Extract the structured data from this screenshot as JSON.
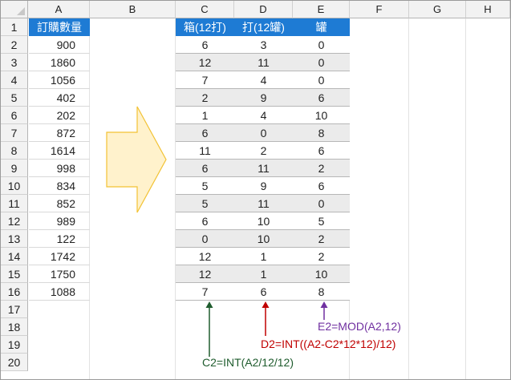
{
  "columns": [
    "A",
    "B",
    "C",
    "D",
    "E",
    "F",
    "G",
    "H"
  ],
  "rows": [
    "1",
    "2",
    "3",
    "4",
    "5",
    "6",
    "7",
    "8",
    "9",
    "10",
    "11",
    "12",
    "13",
    "14",
    "15",
    "16",
    "17",
    "18",
    "19",
    "20"
  ],
  "table_a": {
    "header": "訂購數量",
    "values": [
      "900",
      "1860",
      "1056",
      "402",
      "202",
      "872",
      "1614",
      "998",
      "834",
      "852",
      "989",
      "122",
      "1742",
      "1750",
      "1088"
    ]
  },
  "table_cde": {
    "headers": [
      "箱(12打)",
      "打(12罐)",
      "罐"
    ],
    "rows": [
      [
        "6",
        "3",
        "0"
      ],
      [
        "12",
        "11",
        "0"
      ],
      [
        "7",
        "4",
        "0"
      ],
      [
        "2",
        "9",
        "6"
      ],
      [
        "1",
        "4",
        "10"
      ],
      [
        "6",
        "0",
        "8"
      ],
      [
        "11",
        "2",
        "6"
      ],
      [
        "6",
        "11",
        "2"
      ],
      [
        "5",
        "9",
        "6"
      ],
      [
        "5",
        "11",
        "0"
      ],
      [
        "6",
        "10",
        "5"
      ],
      [
        "0",
        "10",
        "2"
      ],
      [
        "12",
        "1",
        "2"
      ],
      [
        "12",
        "1",
        "10"
      ],
      [
        "7",
        "6",
        "8"
      ]
    ]
  },
  "annotations": {
    "c2": "C2=INT(A2/12/12)",
    "d2": "D2=INT((A2-C2*12*12)/12)",
    "e2": "E2=MOD(A2,12)"
  },
  "colors": {
    "header_fill": "#1e7bd4",
    "band_fill": "#ebebeb",
    "arrow_fill": "#fff2cc",
    "arrow_stroke": "#f2c233",
    "c2_color": "#1f5c2e",
    "d2_color": "#c00000",
    "e2_color": "#7030a0"
  }
}
